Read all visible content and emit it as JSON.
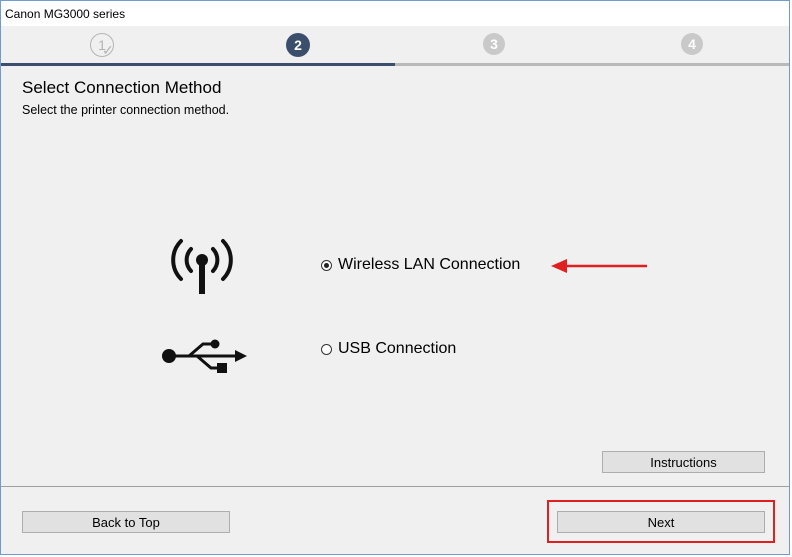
{
  "window": {
    "title": "Canon MG3000 series"
  },
  "steps": [
    {
      "number": "1",
      "state": "done"
    },
    {
      "number": "2",
      "state": "current"
    },
    {
      "number": "3",
      "state": "future"
    },
    {
      "number": "4",
      "state": "future"
    }
  ],
  "progress_fraction": 0.5,
  "page": {
    "heading": "Select Connection Method",
    "subheading": "Select the printer connection method."
  },
  "options": [
    {
      "label": "Wireless LAN Connection",
      "selected": true,
      "icon": "wireless-antenna-icon"
    },
    {
      "label": "USB Connection",
      "selected": false,
      "icon": "usb-icon"
    }
  ],
  "buttons": {
    "instructions": "Instructions",
    "back_to_top": "Back to Top",
    "next": "Next"
  },
  "colors": {
    "accent": "#3b4f6d",
    "annotation": "#e02020"
  }
}
